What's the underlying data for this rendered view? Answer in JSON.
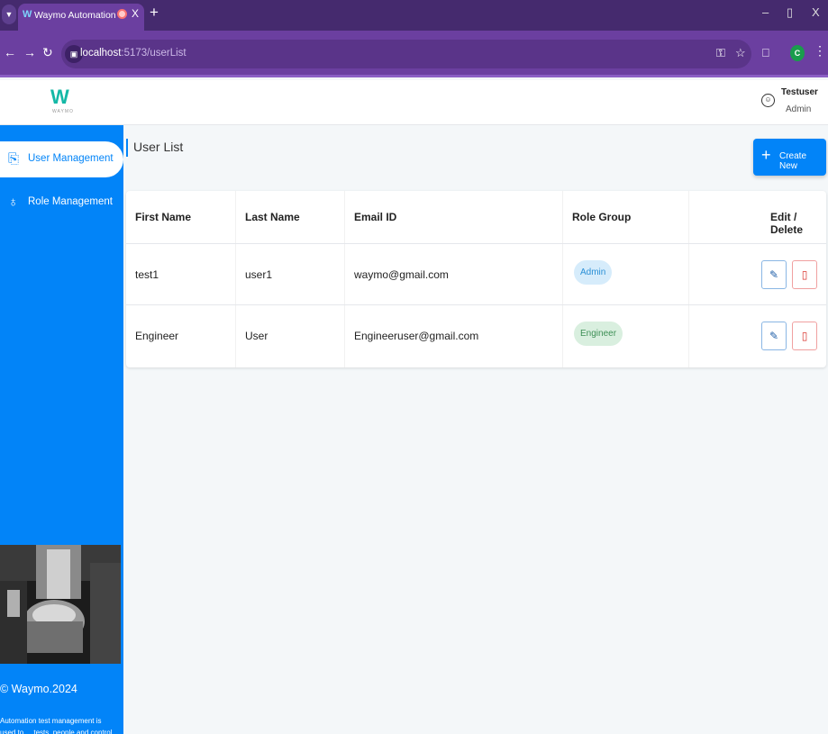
{
  "browser": {
    "tab_title": "Waymo Automation",
    "url_host": "localhost",
    "url_rest": ":5173/userList"
  },
  "header": {
    "logo_text": "WAYMO",
    "user_name": "Testuser",
    "user_role": "Admin"
  },
  "sidebar": {
    "items": [
      {
        "label": "User Management",
        "active": true
      },
      {
        "label": "Role Management",
        "active": false
      }
    ],
    "copyright": "© Waymo.2024",
    "description": "Automation test management is used to ... tests, people and control the"
  },
  "main": {
    "title": "User List",
    "create_label": "Create New",
    "table": {
      "columns": [
        "First Name",
        "Last Name",
        "Email ID",
        "Role Group",
        "Edit / Delete"
      ],
      "rows": [
        {
          "first": "test1",
          "last": "user1",
          "email": "waymo@gmail.com",
          "role": "Admin"
        },
        {
          "first": "Engineer",
          "last": "User",
          "email": "Engineeruser@gmail.com",
          "role": "Engineer"
        }
      ]
    }
  },
  "colors": {
    "sidebar": "#0284f8",
    "tabbar": "#452a6e",
    "toolbar": "#6b3fa0",
    "accent": "#0284f8"
  }
}
